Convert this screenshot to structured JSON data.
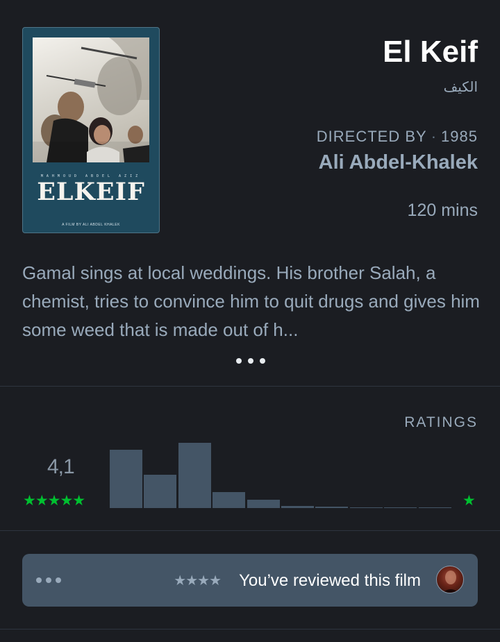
{
  "film": {
    "title": "El Keif",
    "original_title": "الكيف",
    "directed_by_label": "DIRECTED BY",
    "year": "1985",
    "director": "Ali Abdel-Khalek",
    "runtime": "120 mins",
    "synopsis": "Gamal sings at local weddings. His brother Salah, a chemist, tries to convince him to quit drugs and gives him some weed that is made out of h..."
  },
  "poster": {
    "credits": "MAHMOUD ABDEL AZIZ",
    "title": "ELKEIF",
    "tagline": "A FILM BY ALI ABDEL KHALEK"
  },
  "ratings": {
    "label": "RATINGS",
    "average": "4,1",
    "max_stars": "★★★★★",
    "min_star": "★",
    "distribution": [
      0.82,
      0.47,
      0.92,
      0.23,
      0.12,
      0.03,
      0.02,
      0.01,
      0.01,
      0.01
    ],
    "bar_color": "#445566",
    "star_color": "#00c030"
  },
  "review": {
    "stars": "★★★★",
    "text": "You’ve reviewed this film"
  },
  "icons": {
    "more": "ellipsis-icon",
    "options": "ellipsis-icon",
    "avatar": "user-avatar"
  }
}
